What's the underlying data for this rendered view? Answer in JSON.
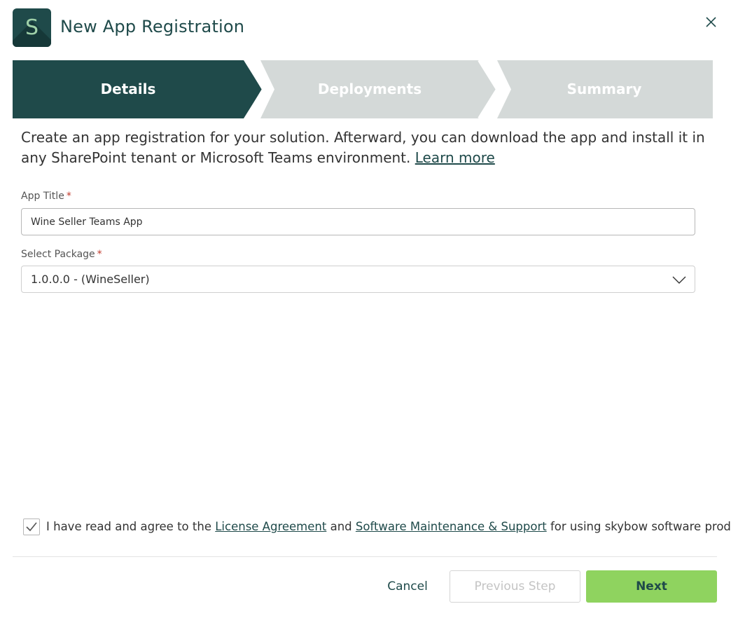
{
  "header": {
    "logo_letter": "S",
    "title": "New App Registration",
    "close_icon": "close-icon"
  },
  "stepper": {
    "steps": [
      {
        "label": "Details",
        "state": "active"
      },
      {
        "label": "Deployments",
        "state": "inactive"
      },
      {
        "label": "Summary",
        "state": "inactive"
      }
    ],
    "colors": {
      "active": "#1f4a4a",
      "inactive": "#d4d9d8"
    }
  },
  "description": {
    "text": "Create an app registration for your solution. Afterward, you can download the app and install it in any SharePoint tenant or Microsoft Teams environment.",
    "link": "Learn more"
  },
  "form": {
    "app_title": {
      "label": "App Title",
      "required": "*",
      "value": "Wine Seller Teams App"
    },
    "package": {
      "label": "Select Package",
      "required": "*",
      "selected": "1.0.0.0 - (WineSeller)"
    }
  },
  "agreement": {
    "checked": true,
    "prefix": "I have read and agree to the",
    "link1": "License Agreement",
    "middle": "and",
    "link2": "Software Maintenance & Support",
    "suffix": "for using skybow software products"
  },
  "footer": {
    "cancel": "Cancel",
    "previous": "Previous Step",
    "next": "Next"
  },
  "colors": {
    "brand_dark": "#1f4a4a",
    "accent_green": "#8fd35f",
    "required": "#c0392b"
  }
}
